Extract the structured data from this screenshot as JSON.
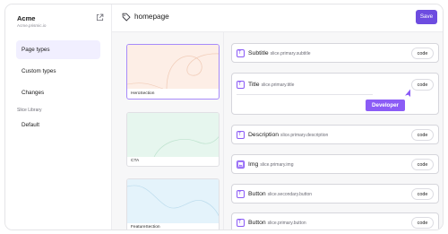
{
  "app": {
    "name": "Acme",
    "domain": "Acme.prismic.io"
  },
  "sidebar": {
    "items": [
      {
        "label": "Page types"
      },
      {
        "label": "Custom types"
      },
      {
        "label": "Changes"
      }
    ],
    "section_label": "Slice Library",
    "section_items": [
      {
        "label": "Default"
      }
    ]
  },
  "header": {
    "title": "homepage",
    "save_label": "Save"
  },
  "slices": [
    {
      "label": "HeroSection"
    },
    {
      "label": "CTA"
    },
    {
      "label": "FeatureSection"
    }
  ],
  "fields": [
    {
      "name": "Subtitle",
      "path": "slice.primary.subtitle",
      "button": "code"
    },
    {
      "name": "Title",
      "path": "slice.primary.title",
      "button": "code"
    },
    {
      "name": "Description",
      "path": "slice.primary.description",
      "button": "code"
    },
    {
      "name": "Img",
      "path": "slice.primary.img",
      "button": "code"
    },
    {
      "name": "Button",
      "path": "slice.secondary.button",
      "button": "code"
    },
    {
      "name": "Button",
      "path": "slice.primary.button",
      "button": "code"
    }
  ],
  "cursor_badge": {
    "label": "Developer"
  },
  "colors": {
    "accent": "#6d4ce0",
    "badge": "#8b5cf6",
    "active_nav": "#f1efff"
  },
  "icons": [
    "external-link-icon",
    "tag-icon",
    "field-type-icon",
    "image-field-icon",
    "pointer-cursor-icon"
  ]
}
